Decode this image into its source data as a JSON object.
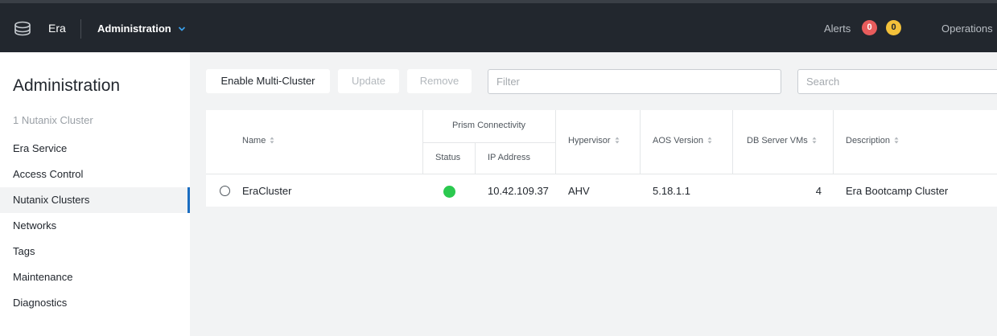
{
  "header": {
    "app_name": "Era",
    "menu_title": "Administration",
    "alerts_label": "Alerts",
    "alerts_critical_count": "0",
    "alerts_warning_count": "0",
    "operations_label": "Operations",
    "colors": {
      "bar": "#22272e",
      "critical": "#e85c5c",
      "warning": "#f3c13a"
    }
  },
  "sidebar": {
    "title": "Administration",
    "subtitle": "1 Nutanix Cluster",
    "items": [
      {
        "label": "Era Service",
        "active": false
      },
      {
        "label": "Access Control",
        "active": false
      },
      {
        "label": "Nutanix Clusters",
        "active": true
      },
      {
        "label": "Networks",
        "active": false
      },
      {
        "label": "Tags",
        "active": false
      },
      {
        "label": "Maintenance",
        "active": false
      },
      {
        "label": "Diagnostics",
        "active": false
      }
    ],
    "active_color": "#1b6dc1"
  },
  "toolbar": {
    "enable_label": "Enable Multi-Cluster",
    "update_label": "Update",
    "remove_label": "Remove",
    "filter_placeholder": "Filter",
    "search_placeholder": "Search"
  },
  "table": {
    "group_header": "Prism Connectivity",
    "columns": {
      "name": "Name",
      "status": "Status",
      "ip": "IP Address",
      "hypervisor": "Hypervisor",
      "aos": "AOS Version",
      "dbvms": "DB Server VMs",
      "description": "Description"
    },
    "rows": [
      {
        "name": "EraCluster",
        "status": "connected",
        "status_color": "#2bc94f",
        "ip": "10.42.109.37",
        "hypervisor": "AHV",
        "aos": "5.18.1.1",
        "dbvms": "4",
        "description": "Era Bootcamp Cluster"
      }
    ]
  }
}
